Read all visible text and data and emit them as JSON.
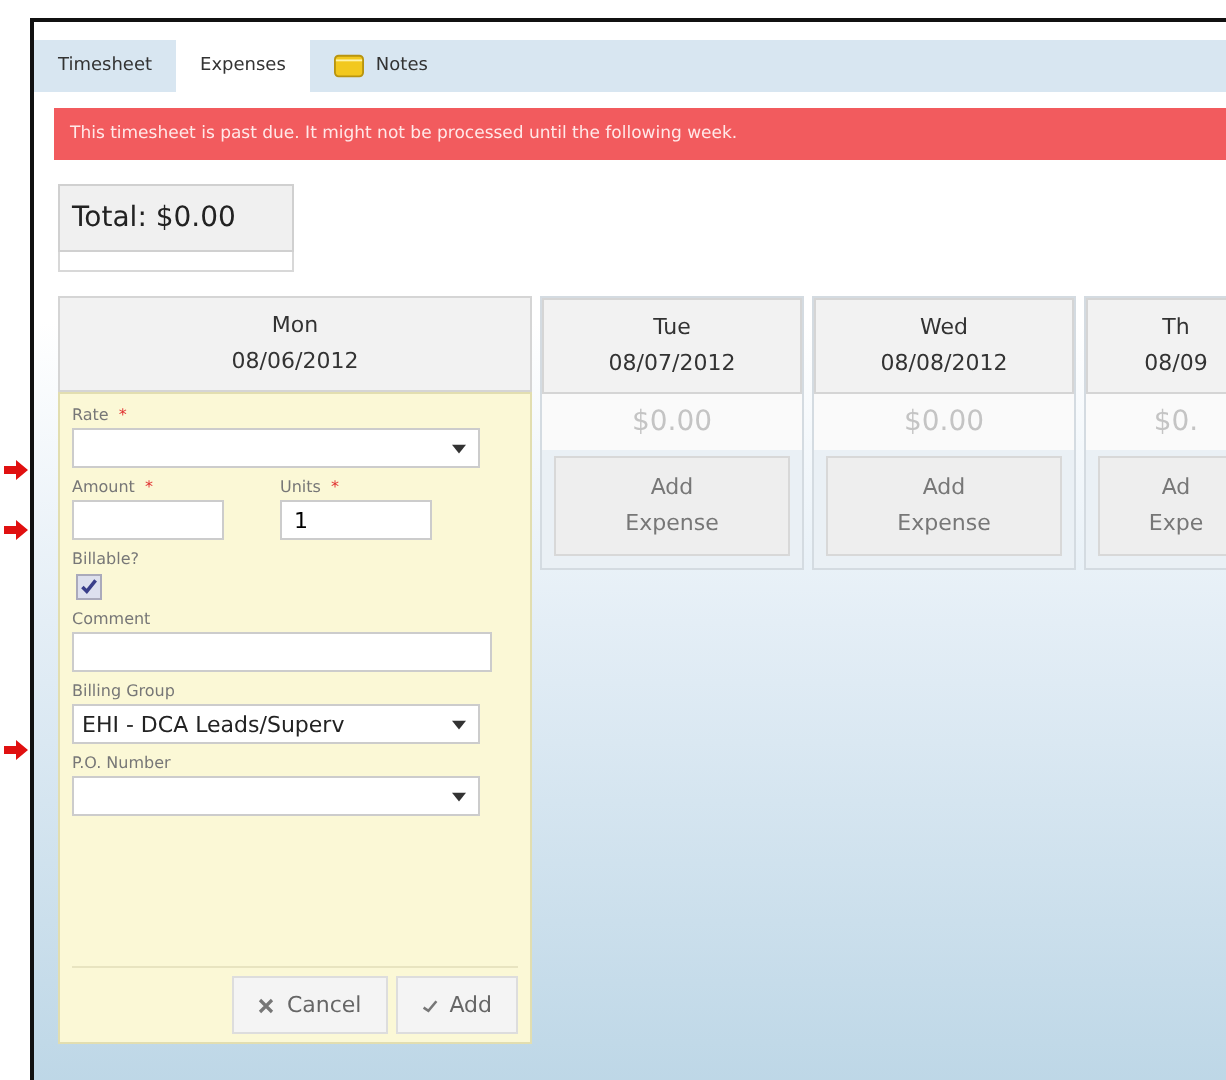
{
  "tabs": [
    {
      "label": "Timesheet",
      "selected": false,
      "icon": false
    },
    {
      "label": "Expenses",
      "selected": true,
      "icon": false
    },
    {
      "label": "Notes",
      "selected": false,
      "icon": true
    }
  ],
  "alert": "This timesheet is past due. It might not be processed until the following week.",
  "total": "Total: $0.00",
  "days": [
    {
      "kind": "form",
      "day": "Mon",
      "date": "08/06/2012",
      "rows": [
        {
          "fields": [
            {
              "kind": "select",
              "label": "Rate",
              "mark": "*"
            }
          ]
        },
        {
          "fields": [
            {
              "kind": "text",
              "label": "Amount",
              "mark": "*"
            },
            {
              "kind": "text",
              "label": "Units",
              "mark": "*",
              "value": "1"
            }
          ]
        },
        {
          "fields": [
            {
              "kind": "checkbox",
              "label": "Billable?",
              "checked": true
            }
          ]
        },
        {
          "fields": [
            {
              "kind": "text",
              "label": "Comment"
            }
          ]
        },
        {
          "fields": [
            {
              "kind": "select",
              "label": "Billing Group",
              "value": "EHI - DCA Leads/Superv"
            }
          ]
        },
        {
          "fields": [
            {
              "kind": "select",
              "label": "P.O. Number"
            }
          ]
        }
      ],
      "buttons": [
        {
          "kind": "cancel",
          "label": "Cancel"
        },
        {
          "kind": "add",
          "label": "Add"
        }
      ]
    },
    {
      "kind": "summary",
      "day": "Tue",
      "date": "08/07/2012",
      "amount": "$0.00",
      "button": [
        "Add",
        "Expense"
      ]
    },
    {
      "kind": "summary",
      "day": "Wed",
      "date": "08/08/2012",
      "amount": "$0.00",
      "button": [
        "Add",
        "Expense"
      ]
    },
    {
      "kind": "summary",
      "day": "Th",
      "date": "08/09",
      "amount": "$0.",
      "button": [
        "Ad",
        "Expe"
      ]
    }
  ]
}
